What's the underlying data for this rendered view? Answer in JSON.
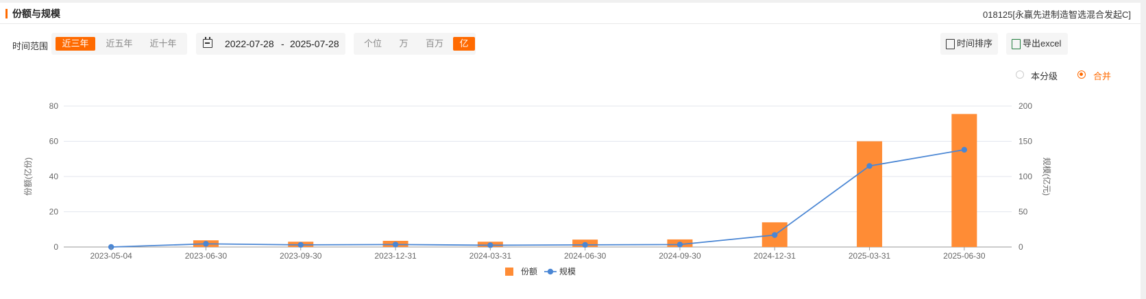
{
  "header": {
    "title": "份额与规模",
    "fund_name": "018125[永赢先进制造智选混合发起C]"
  },
  "toolbar": {
    "range_label": "时间范围",
    "ranges": [
      {
        "label": "近三年",
        "active": true
      },
      {
        "label": "近五年",
        "active": false
      },
      {
        "label": "近十年",
        "active": false
      }
    ],
    "date_start": "2022-07-28",
    "date_sep": "-",
    "date_end": "2025-07-28",
    "units": [
      {
        "label": "个位",
        "active": false
      },
      {
        "label": "万",
        "active": false
      },
      {
        "label": "百万",
        "active": false
      },
      {
        "label": "亿",
        "active": true
      }
    ],
    "sort_label": "时间排序",
    "export_label": "导出excel"
  },
  "toggle": {
    "option_a": "本分级",
    "option_b": "合并",
    "selected": "合并"
  },
  "colors": {
    "accent": "#ff6a00",
    "bar": "#ff8c35",
    "line": "#4a86d4"
  },
  "chart_data": {
    "type": "bar+line",
    "categories": [
      "2023-05-04",
      "2023-06-30",
      "2023-09-30",
      "2023-12-31",
      "2024-03-31",
      "2024-06-30",
      "2024-09-30",
      "2024-12-31",
      "2025-03-31",
      "2025-06-30"
    ],
    "series": [
      {
        "name": "份额",
        "type": "bar",
        "axis": "left",
        "values": [
          0,
          3.8,
          3.0,
          3.5,
          3.0,
          4.2,
          4.3,
          14.0,
          60.0,
          75.5
        ]
      },
      {
        "name": "规模",
        "type": "line",
        "axis": "right",
        "values": [
          0,
          4.5,
          3.0,
          3.5,
          2.5,
          3.0,
          3.5,
          17.0,
          115.0,
          138.0
        ]
      }
    ],
    "ylabel": "份额(亿份)",
    "y2label": "规模(亿元)",
    "ylim": [
      0,
      80
    ],
    "y2lim": [
      0,
      200
    ],
    "yticks": [
      0,
      20,
      40,
      60,
      80
    ],
    "y2ticks": [
      0,
      50,
      100,
      150,
      200
    ],
    "grid": true,
    "legend": "bottom"
  }
}
